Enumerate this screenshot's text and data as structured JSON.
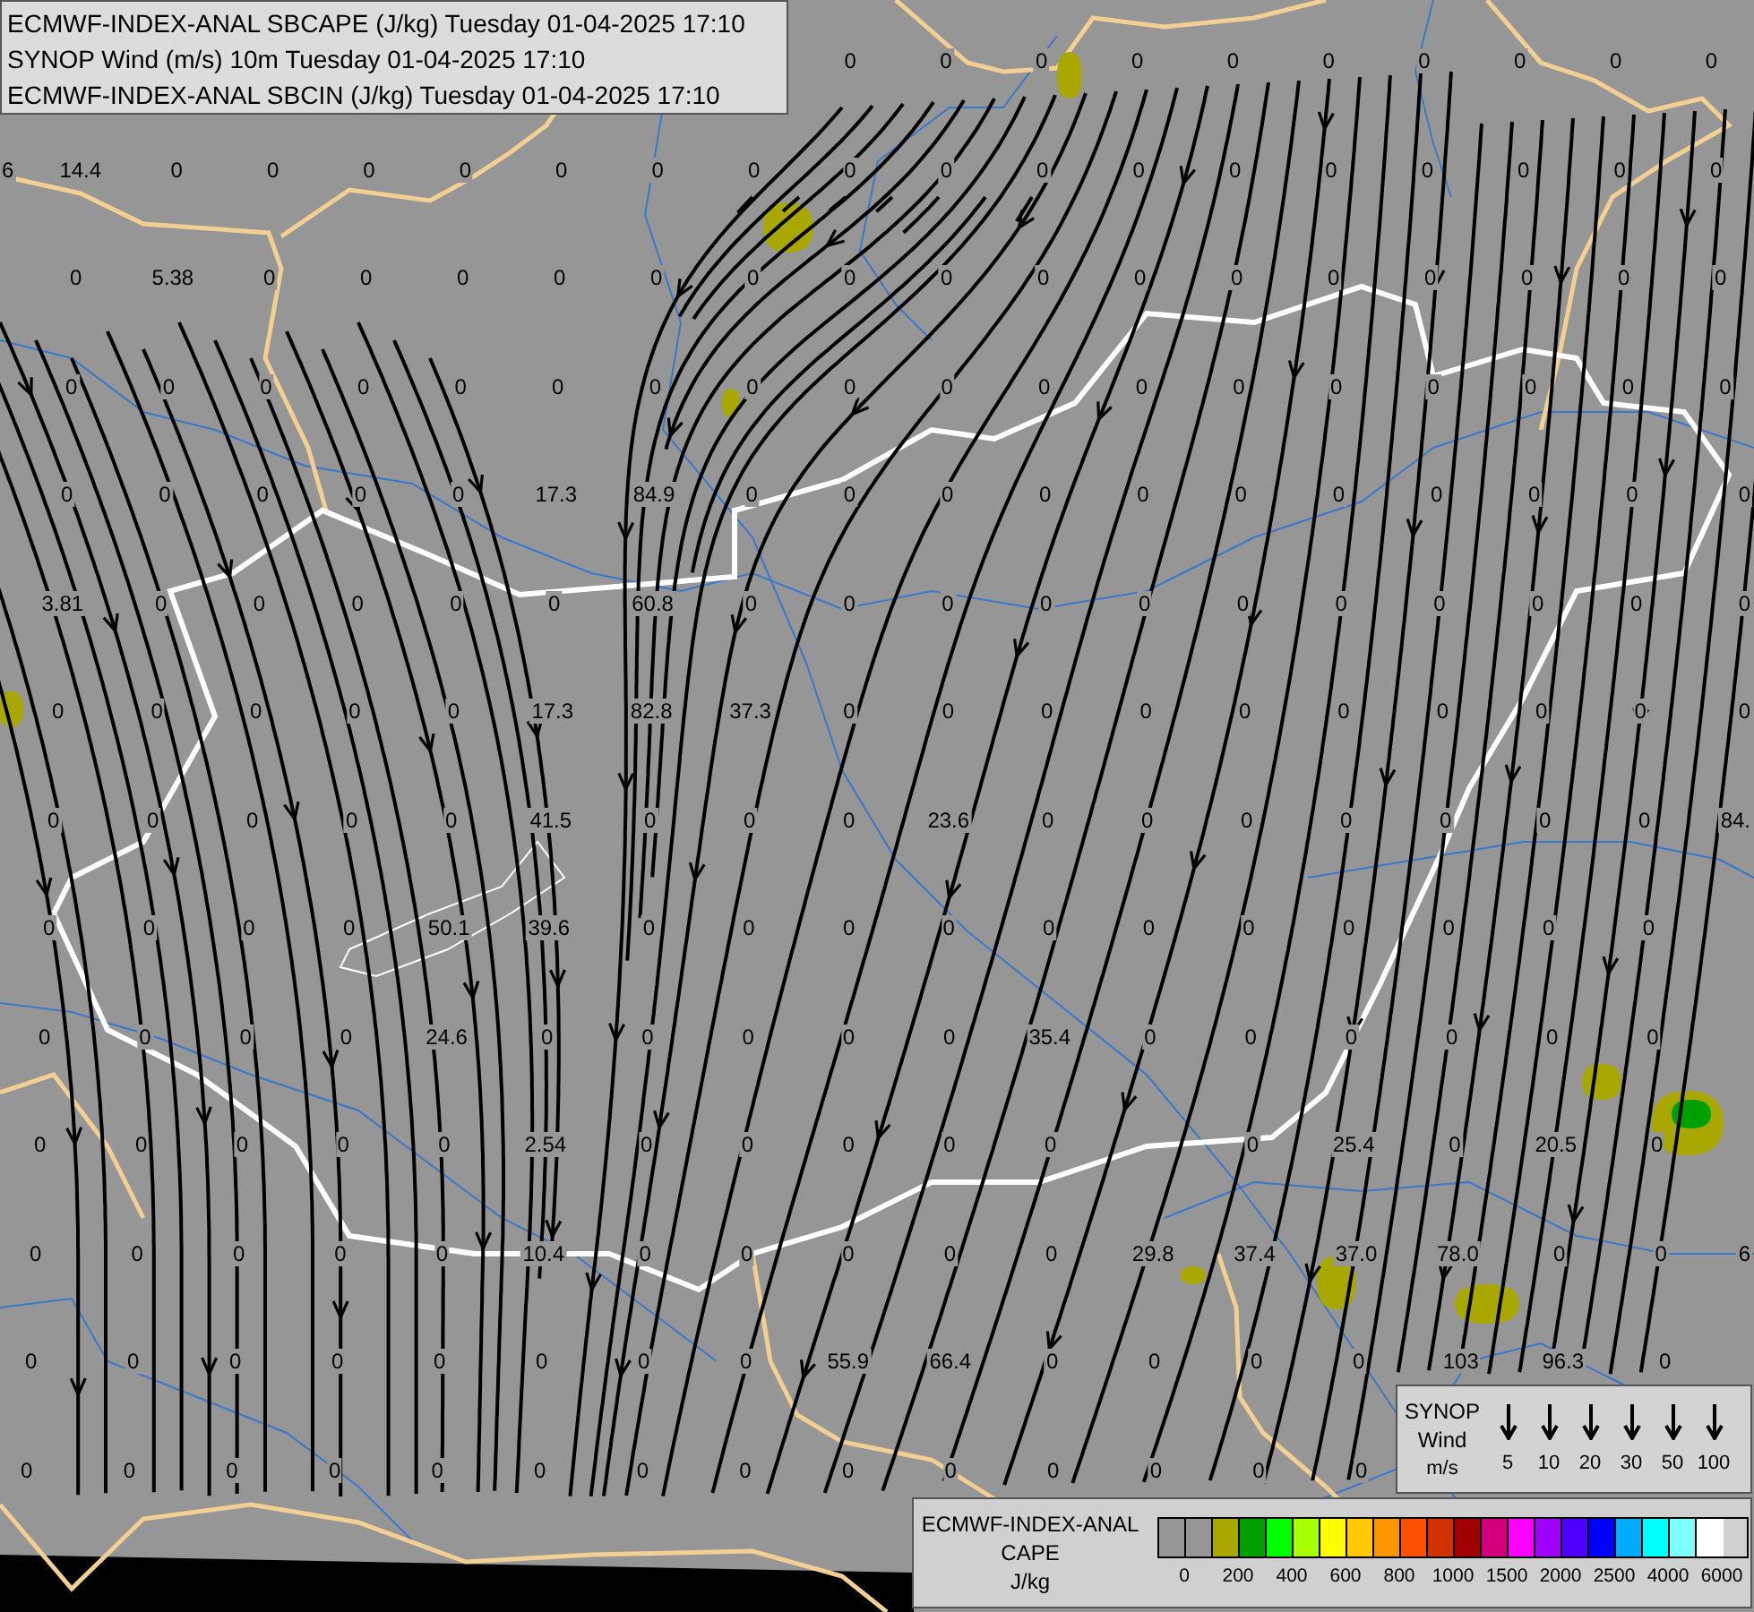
{
  "title_box": {
    "lines": [
      "ECMWF-INDEX-ANAL SBCAPE (J/kg) Tuesday 01-04-2025 17:10",
      "SYNOP Wind (m/s) 10m Tuesday 01-04-2025 17:10",
      "ECMWF-INDEX-ANAL SBCIN (J/kg) Tuesday 01-04-2025 17:10"
    ]
  },
  "station_values": [
    [
      {
        "kind": "gap"
      },
      {
        "kind": "gap"
      },
      {
        "kind": "gap"
      },
      {
        "kind": "gap"
      },
      {
        "kind": "gap"
      },
      {
        "kind": "gap"
      },
      {
        "kind": "gap"
      },
      {
        "kind": "gap"
      },
      {
        "kind": "gap"
      },
      {
        "kind": "value",
        "text": "0"
      },
      {
        "kind": "value",
        "text": "0"
      },
      {
        "kind": "value",
        "text": "0"
      },
      {
        "kind": "value",
        "text": "0"
      },
      {
        "kind": "value",
        "text": "0"
      },
      {
        "kind": "value",
        "text": "0"
      },
      {
        "kind": "value",
        "text": "0"
      },
      {
        "kind": "value",
        "text": "0"
      },
      {
        "kind": "value",
        "text": "0"
      },
      {
        "kind": "value",
        "text": "0"
      }
    ],
    [
      {
        "kind": "value",
        "text": "6"
      },
      {
        "kind": "value",
        "text": "14.4"
      },
      {
        "kind": "value",
        "text": "0"
      },
      {
        "kind": "value",
        "text": "0"
      },
      {
        "kind": "value",
        "text": "0"
      },
      {
        "kind": "value",
        "text": "0"
      },
      {
        "kind": "value",
        "text": "0"
      },
      {
        "kind": "value",
        "text": "0"
      },
      {
        "kind": "value",
        "text": "0"
      },
      {
        "kind": "value",
        "text": "0"
      },
      {
        "kind": "value",
        "text": "0"
      },
      {
        "kind": "value",
        "text": "0"
      },
      {
        "kind": "value",
        "text": "0"
      },
      {
        "kind": "value",
        "text": "0"
      },
      {
        "kind": "value",
        "text": "0"
      },
      {
        "kind": "value",
        "text": "0"
      },
      {
        "kind": "value",
        "text": "0"
      },
      {
        "kind": "value",
        "text": "0"
      },
      {
        "kind": "value",
        "text": "0"
      }
    ],
    [
      {
        "kind": "gap"
      },
      {
        "kind": "value",
        "text": "0"
      },
      {
        "kind": "value",
        "text": "5.38"
      },
      {
        "kind": "value",
        "text": "0"
      },
      {
        "kind": "value",
        "text": "0"
      },
      {
        "kind": "value",
        "text": "0"
      },
      {
        "kind": "value",
        "text": "0"
      },
      {
        "kind": "value",
        "text": "0"
      },
      {
        "kind": "value",
        "text": "0"
      },
      {
        "kind": "value",
        "text": "0"
      },
      {
        "kind": "value",
        "text": "0"
      },
      {
        "kind": "value",
        "text": "0"
      },
      {
        "kind": "value",
        "text": "0"
      },
      {
        "kind": "value",
        "text": "0"
      },
      {
        "kind": "value",
        "text": "0"
      },
      {
        "kind": "value",
        "text": "0"
      },
      {
        "kind": "value",
        "text": "0"
      },
      {
        "kind": "value",
        "text": "0"
      },
      {
        "kind": "value",
        "text": "0"
      }
    ],
    [
      {
        "kind": "gap"
      },
      {
        "kind": "value",
        "text": "0"
      },
      {
        "kind": "value",
        "text": "0"
      },
      {
        "kind": "value",
        "text": "0"
      },
      {
        "kind": "value",
        "text": "0"
      },
      {
        "kind": "value",
        "text": "0"
      },
      {
        "kind": "value",
        "text": "0"
      },
      {
        "kind": "value",
        "text": "0"
      },
      {
        "kind": "value",
        "text": "0"
      },
      {
        "kind": "value",
        "text": "0"
      },
      {
        "kind": "value",
        "text": "0"
      },
      {
        "kind": "value",
        "text": "0"
      },
      {
        "kind": "value",
        "text": "0"
      },
      {
        "kind": "value",
        "text": "0"
      },
      {
        "kind": "value",
        "text": "0"
      },
      {
        "kind": "value",
        "text": "0"
      },
      {
        "kind": "value",
        "text": "0"
      },
      {
        "kind": "value",
        "text": "0"
      },
      {
        "kind": "value",
        "text": "0"
      }
    ],
    [
      {
        "kind": "gap"
      },
      {
        "kind": "value",
        "text": "0"
      },
      {
        "kind": "value",
        "text": "0"
      },
      {
        "kind": "value",
        "text": "0"
      },
      {
        "kind": "value",
        "text": "0"
      },
      {
        "kind": "value",
        "text": "0"
      },
      {
        "kind": "value",
        "text": "17.3"
      },
      {
        "kind": "value",
        "text": "84.9"
      },
      {
        "kind": "value",
        "text": "0"
      },
      {
        "kind": "value",
        "text": "0"
      },
      {
        "kind": "value",
        "text": "0"
      },
      {
        "kind": "value",
        "text": "0"
      },
      {
        "kind": "value",
        "text": "0"
      },
      {
        "kind": "value",
        "text": "0"
      },
      {
        "kind": "value",
        "text": "0"
      },
      {
        "kind": "value",
        "text": "0"
      },
      {
        "kind": "value",
        "text": "0"
      },
      {
        "kind": "value",
        "text": "0"
      },
      {
        "kind": "value",
        "text": "0"
      }
    ],
    [
      {
        "kind": "gap"
      },
      {
        "kind": "value",
        "text": "3.81"
      },
      {
        "kind": "value",
        "text": "0"
      },
      {
        "kind": "value",
        "text": "0"
      },
      {
        "kind": "value",
        "text": "0"
      },
      {
        "kind": "value",
        "text": "0"
      },
      {
        "kind": "value",
        "text": "0"
      },
      {
        "kind": "value",
        "text": "60.8"
      },
      {
        "kind": "value",
        "text": "0"
      },
      {
        "kind": "value",
        "text": "0"
      },
      {
        "kind": "value",
        "text": "0"
      },
      {
        "kind": "value",
        "text": "0"
      },
      {
        "kind": "value",
        "text": "0"
      },
      {
        "kind": "value",
        "text": "0"
      },
      {
        "kind": "value",
        "text": "0"
      },
      {
        "kind": "value",
        "text": "0"
      },
      {
        "kind": "value",
        "text": "0"
      },
      {
        "kind": "value",
        "text": "0"
      },
      {
        "kind": "value",
        "text": "0"
      }
    ],
    [
      {
        "kind": "gap"
      },
      {
        "kind": "value",
        "text": "0"
      },
      {
        "kind": "value",
        "text": "0"
      },
      {
        "kind": "value",
        "text": "0"
      },
      {
        "kind": "value",
        "text": "0"
      },
      {
        "kind": "value",
        "text": "0"
      },
      {
        "kind": "value",
        "text": "17.3"
      },
      {
        "kind": "value",
        "text": "82.8"
      },
      {
        "kind": "value",
        "text": "37.3"
      },
      {
        "kind": "value",
        "text": "0"
      },
      {
        "kind": "value",
        "text": "0"
      },
      {
        "kind": "value",
        "text": "0"
      },
      {
        "kind": "value",
        "text": "0"
      },
      {
        "kind": "value",
        "text": "0"
      },
      {
        "kind": "value",
        "text": "0"
      },
      {
        "kind": "value",
        "text": "0"
      },
      {
        "kind": "value",
        "text": "0"
      },
      {
        "kind": "value",
        "text": "0"
      },
      {
        "kind": "value",
        "text": "0"
      }
    ],
    [
      {
        "kind": "gap"
      },
      {
        "kind": "value",
        "text": "0"
      },
      {
        "kind": "value",
        "text": "0"
      },
      {
        "kind": "value",
        "text": "0"
      },
      {
        "kind": "value",
        "text": "0"
      },
      {
        "kind": "value",
        "text": "0"
      },
      {
        "kind": "value",
        "text": "41.5"
      },
      {
        "kind": "value",
        "text": "0"
      },
      {
        "kind": "value",
        "text": "0"
      },
      {
        "kind": "value",
        "text": "0"
      },
      {
        "kind": "value",
        "text": "23.6"
      },
      {
        "kind": "value",
        "text": "0"
      },
      {
        "kind": "value",
        "text": "0"
      },
      {
        "kind": "value",
        "text": "0"
      },
      {
        "kind": "value",
        "text": "0"
      },
      {
        "kind": "value",
        "text": "0"
      },
      {
        "kind": "value",
        "text": "0"
      },
      {
        "kind": "value",
        "text": "0"
      },
      {
        "kind": "value",
        "text": "84."
      }
    ],
    [
      {
        "kind": "gap"
      },
      {
        "kind": "value",
        "text": "0"
      },
      {
        "kind": "value",
        "text": "0"
      },
      {
        "kind": "value",
        "text": "0"
      },
      {
        "kind": "value",
        "text": "0"
      },
      {
        "kind": "value",
        "text": "50.1"
      },
      {
        "kind": "value",
        "text": "39.6"
      },
      {
        "kind": "value",
        "text": "0"
      },
      {
        "kind": "value",
        "text": "0"
      },
      {
        "kind": "value",
        "text": "0"
      },
      {
        "kind": "value",
        "text": "0"
      },
      {
        "kind": "value",
        "text": "0"
      },
      {
        "kind": "value",
        "text": "0"
      },
      {
        "kind": "value",
        "text": "0"
      },
      {
        "kind": "value",
        "text": "0"
      },
      {
        "kind": "value",
        "text": "0"
      },
      {
        "kind": "value",
        "text": "0"
      },
      {
        "kind": "value",
        "text": "0"
      }
    ],
    [
      {
        "kind": "gap"
      },
      {
        "kind": "value",
        "text": "0"
      },
      {
        "kind": "value",
        "text": "0"
      },
      {
        "kind": "value",
        "text": "0"
      },
      {
        "kind": "value",
        "text": "0"
      },
      {
        "kind": "value",
        "text": "24.6"
      },
      {
        "kind": "value",
        "text": "0"
      },
      {
        "kind": "value",
        "text": "0"
      },
      {
        "kind": "value",
        "text": "0"
      },
      {
        "kind": "value",
        "text": "0"
      },
      {
        "kind": "value",
        "text": "0"
      },
      {
        "kind": "value",
        "text": "35.4"
      },
      {
        "kind": "value",
        "text": "0"
      },
      {
        "kind": "value",
        "text": "0"
      },
      {
        "kind": "value",
        "text": "0"
      },
      {
        "kind": "value",
        "text": "0"
      },
      {
        "kind": "value",
        "text": "0"
      },
      {
        "kind": "value",
        "text": "0"
      }
    ],
    [
      {
        "kind": "gap"
      },
      {
        "kind": "value",
        "text": "0"
      },
      {
        "kind": "value",
        "text": "0"
      },
      {
        "kind": "value",
        "text": "0"
      },
      {
        "kind": "value",
        "text": "0"
      },
      {
        "kind": "value",
        "text": "0"
      },
      {
        "kind": "value",
        "text": "2.54"
      },
      {
        "kind": "value",
        "text": "0"
      },
      {
        "kind": "value",
        "text": "0"
      },
      {
        "kind": "value",
        "text": "0"
      },
      {
        "kind": "value",
        "text": "0"
      },
      {
        "kind": "value",
        "text": "0"
      },
      {
        "kind": "gap"
      },
      {
        "kind": "value",
        "text": "0"
      },
      {
        "kind": "value",
        "text": "25.4"
      },
      {
        "kind": "value",
        "text": "0"
      },
      {
        "kind": "value",
        "text": "20.5"
      },
      {
        "kind": "value",
        "text": "0"
      }
    ],
    [
      {
        "kind": "gap"
      },
      {
        "kind": "value",
        "text": "0"
      },
      {
        "kind": "value",
        "text": "0"
      },
      {
        "kind": "value",
        "text": "0"
      },
      {
        "kind": "value",
        "text": "0"
      },
      {
        "kind": "value",
        "text": "0"
      },
      {
        "kind": "value",
        "text": "10.4"
      },
      {
        "kind": "value",
        "text": "0"
      },
      {
        "kind": "value",
        "text": "0"
      },
      {
        "kind": "value",
        "text": "0"
      },
      {
        "kind": "value",
        "text": "0"
      },
      {
        "kind": "value",
        "text": "0"
      },
      {
        "kind": "value",
        "text": "29.8"
      },
      {
        "kind": "value",
        "text": "37.4"
      },
      {
        "kind": "value",
        "text": "37.0"
      },
      {
        "kind": "value",
        "text": "78.0"
      },
      {
        "kind": "value",
        "text": "0"
      },
      {
        "kind": "value",
        "text": "0"
      },
      {
        "kind": "value",
        "text": "6"
      }
    ],
    [
      {
        "kind": "gap"
      },
      {
        "kind": "value",
        "text": "0"
      },
      {
        "kind": "value",
        "text": "0"
      },
      {
        "kind": "value",
        "text": "0"
      },
      {
        "kind": "value",
        "text": "0"
      },
      {
        "kind": "value",
        "text": "0"
      },
      {
        "kind": "value",
        "text": "0"
      },
      {
        "kind": "value",
        "text": "0"
      },
      {
        "kind": "value",
        "text": "0"
      },
      {
        "kind": "value",
        "text": "55.9"
      },
      {
        "kind": "value",
        "text": "66.4"
      },
      {
        "kind": "value",
        "text": "0"
      },
      {
        "kind": "value",
        "text": "0"
      },
      {
        "kind": "value",
        "text": "0"
      },
      {
        "kind": "value",
        "text": "0"
      },
      {
        "kind": "value",
        "text": "103"
      },
      {
        "kind": "value",
        "text": "96.3"
      },
      {
        "kind": "value",
        "text": "0"
      }
    ],
    [
      {
        "kind": "gap"
      },
      {
        "kind": "value",
        "text": "0"
      },
      {
        "kind": "value",
        "text": "0"
      },
      {
        "kind": "value",
        "text": "0"
      },
      {
        "kind": "value",
        "text": "0"
      },
      {
        "kind": "value",
        "text": "0"
      },
      {
        "kind": "value",
        "text": "0"
      },
      {
        "kind": "value",
        "text": "0"
      },
      {
        "kind": "value",
        "text": "0"
      },
      {
        "kind": "value",
        "text": "0"
      },
      {
        "kind": "value",
        "text": "0"
      },
      {
        "kind": "value",
        "text": "0"
      },
      {
        "kind": "value",
        "text": "0"
      },
      {
        "kind": "value",
        "text": "0"
      },
      {
        "kind": "value",
        "text": "0"
      }
    ]
  ],
  "wind_legend": {
    "lines": [
      "SYNOP",
      "Wind",
      "m/s"
    ],
    "speeds": [
      "5",
      "10",
      "20",
      "30",
      "50",
      "100"
    ]
  },
  "cape_legend": {
    "lines": [
      "ECMWF-INDEX-ANAL",
      "CAPE",
      "J/kg"
    ],
    "colors": [
      {
        "color": "#969696"
      },
      {
        "color": "#969696"
      },
      {
        "color": "#a8a800"
      },
      {
        "color": "#00a000"
      },
      {
        "color": "#00ff00"
      },
      {
        "color": "#a8ff00"
      },
      {
        "color": "#ffff00"
      },
      {
        "color": "#ffc800"
      },
      {
        "color": "#ff9600"
      },
      {
        "color": "#ff5000"
      },
      {
        "color": "#d23200"
      },
      {
        "color": "#a00000"
      },
      {
        "color": "#d2007d"
      },
      {
        "color": "#ff00ff"
      },
      {
        "color": "#a000ff"
      },
      {
        "color": "#5000ff"
      },
      {
        "color": "#0000ff"
      },
      {
        "color": "#00aaff"
      },
      {
        "color": "#00ffff"
      },
      {
        "color": "#80ffff"
      },
      {
        "color": "#ffffff"
      }
    ],
    "ticks": [
      "0",
      "200",
      "400",
      "600",
      "800",
      "1000",
      "1500",
      "2000",
      "2500",
      "4000",
      "6000"
    ]
  }
}
